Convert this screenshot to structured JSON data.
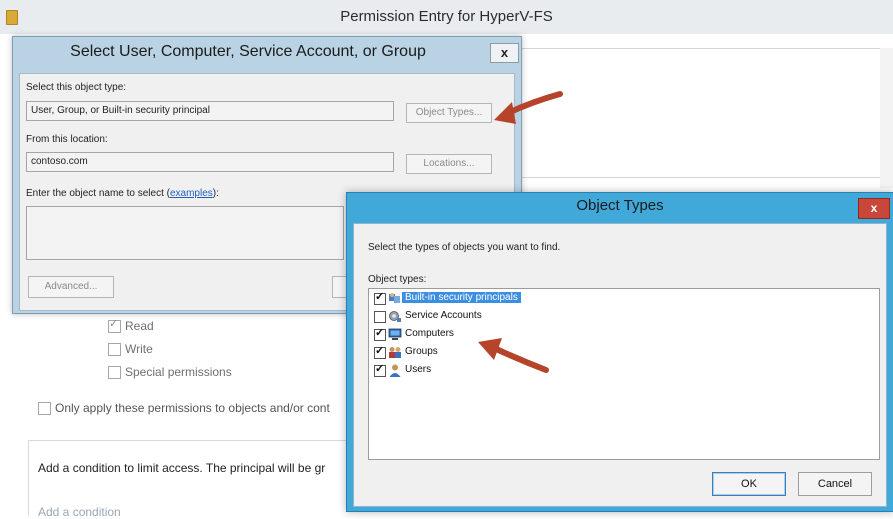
{
  "background_window": {
    "title": "Permission Entry for HyperV-FS",
    "permissions": [
      {
        "label": "Read",
        "checked": true
      },
      {
        "label": "Write",
        "checked": false
      },
      {
        "label": "Special permissions",
        "checked": false
      }
    ],
    "apply_only_label": "Only apply these permissions to objects and/or cont",
    "condition_text": "Add a condition to limit access. The principal will be gr",
    "add_condition_link": "Add a condition"
  },
  "select_dialog": {
    "title": "Select User, Computer, Service Account, or Group",
    "close_label": "x",
    "object_type_label": "Select this object type:",
    "object_type_value": "User, Group, or Built-in security principal",
    "object_types_button": "Object Types...",
    "location_label": "From this location:",
    "location_value": "contoso.com",
    "locations_button": "Locations...",
    "enter_name_label": "Enter the object name to select (",
    "examples_link": "examples",
    "enter_name_suffix": "):",
    "advanced_button": "Advanced..."
  },
  "object_types_dialog": {
    "title": "Object Types",
    "close_label": "x",
    "instruction": "Select the types of objects you want to find.",
    "list_label": "Object types:",
    "items": [
      {
        "label": "Built-in security principals",
        "checked": true,
        "selected": true,
        "icon": "security-principals-icon"
      },
      {
        "label": "Service Accounts",
        "checked": false,
        "selected": false,
        "icon": "service-accounts-icon"
      },
      {
        "label": "Computers",
        "checked": true,
        "selected": false,
        "icon": "computer-icon"
      },
      {
        "label": "Groups",
        "checked": true,
        "selected": false,
        "icon": "groups-icon"
      },
      {
        "label": "Users",
        "checked": true,
        "selected": false,
        "icon": "user-icon"
      }
    ],
    "ok_button": "OK",
    "cancel_button": "Cancel"
  },
  "colors": {
    "annotation_arrow": "#b5442b",
    "object_types_titlebar": "#41a9d9",
    "select_dialog_frame": "#b9d3e5"
  }
}
